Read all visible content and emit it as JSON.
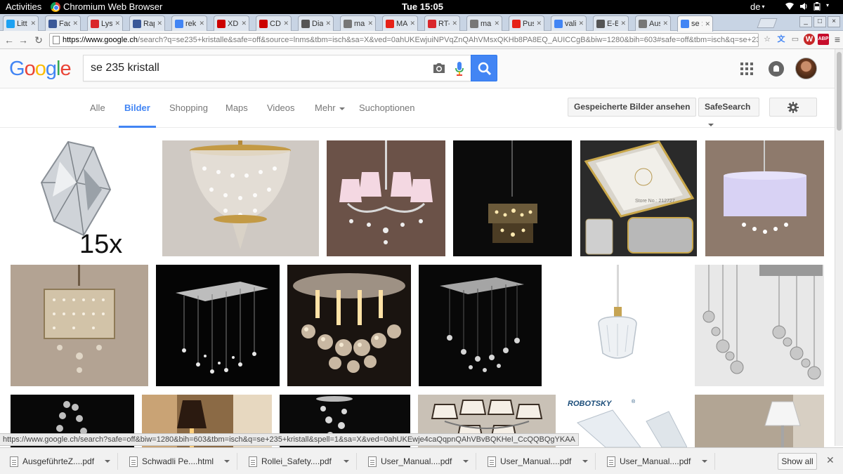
{
  "system_bar": {
    "activities": "Activities",
    "app_name": "Chromium Web Browser",
    "clock": "Tue 15:05",
    "keyboard_layout": "de"
  },
  "tabs": [
    {
      "label": "Litt",
      "icon": "twitter-icon",
      "color": "#1da1f2"
    },
    {
      "label": "Fac",
      "icon": "facebook-icon",
      "color": "#3b5998"
    },
    {
      "label": "Lys",
      "icon": "lys-icon",
      "color": "#d9262c"
    },
    {
      "label": "Rap",
      "icon": "facebook-icon",
      "color": "#3b5998"
    },
    {
      "label": "rek",
      "icon": "google-icon",
      "color": "#4285f4"
    },
    {
      "label": "XD",
      "icon": "digikey-icon",
      "color": "#cc0000"
    },
    {
      "label": "CD",
      "icon": "digikey-icon",
      "color": "#cc0000"
    },
    {
      "label": "Dia",
      "icon": "settings-icon",
      "color": "#555555"
    },
    {
      "label": "mar",
      "icon": "document-icon",
      "color": "#777777"
    },
    {
      "label": "MA",
      "icon": "youtube-icon",
      "color": "#e62117"
    },
    {
      "label": "RT-",
      "icon": "rt-icon",
      "color": "#d9262c"
    },
    {
      "label": "mar",
      "icon": "document-icon",
      "color": "#777777"
    },
    {
      "label": "Pus",
      "icon": "youtube-icon",
      "color": "#e62117"
    },
    {
      "label": "vali",
      "icon": "google-icon",
      "color": "#4285f4"
    },
    {
      "label": "E-B",
      "icon": "settings-icon",
      "color": "#555555"
    },
    {
      "label": "Aus",
      "icon": "document-icon",
      "color": "#777777"
    },
    {
      "label": "se :",
      "icon": "google-icon",
      "color": "#4285f4",
      "active": true
    }
  ],
  "omnibox": {
    "host": "https://www.google.ch",
    "path": "/search?q=se235+kristalle&safe=off&source=lnms&tbm=isch&sa=X&ved=0ahUKEwjuiNPVqZnQAhVMsxQKHb8PA8EQ_AUICCgB&biw=1280&bih=603#safe=off&tbm=isch&q=se+235+kristall"
  },
  "extensions": [
    {
      "icon": "shield-ext-icon",
      "glyph": "W",
      "color": "#c62828"
    },
    {
      "icon": "adblock-ext-icon",
      "glyph": "ABP",
      "badge": "31",
      "color": "#c70d2c"
    }
  ],
  "google": {
    "logo_letters": [
      "G",
      "o",
      "o",
      "g",
      "l",
      "e"
    ],
    "search_query": "se 235 kristall",
    "nav_tabs": [
      "Alle",
      "Bilder",
      "Shopping",
      "Maps",
      "Videos",
      "Mehr",
      "Suchoptionen"
    ],
    "active_tab": "Bilder",
    "saved_images_button": "Gespeicherte Bilder ansehen",
    "safesearch_button": "SafeSearch"
  },
  "results": {
    "row1": [
      {
        "subject": "crystal teardrop prism",
        "overlay": "15x",
        "bg": "#ffffff"
      },
      {
        "subject": "gold crystal basket chandelier",
        "bg": "#cfc9c3"
      },
      {
        "subject": "chandelier with pink lamp shades",
        "bg": "#6b5248"
      },
      {
        "subject": "drum crystal pendant on black",
        "bg": "#0b0b0b"
      },
      {
        "subject": "gold transparent phone case",
        "overlay": "Store No.: 212727",
        "bg": "#2a2a2a"
      },
      {
        "subject": "white drum crystal chandelier",
        "bg": "#8e7a6c"
      }
    ],
    "row2": [
      {
        "subject": "crystal drum chandelier",
        "bg": "#b3a393"
      },
      {
        "subject": "square crystal rain chandelier",
        "bg": "#050505"
      },
      {
        "subject": "round crystal ball ceiling lamp",
        "bg": "#1a1410"
      },
      {
        "subject": "square crystal ball ceiling lamp",
        "bg": "#080808"
      },
      {
        "subject": "glass pendant lamp",
        "bg": "#ffffff"
      },
      {
        "subject": "crystal ball spiral chandeliers",
        "bg": "#e8e8e8"
      }
    ],
    "row3": [
      {
        "subject": "crystal strand chandelier",
        "bg": "#080808"
      },
      {
        "subject": "lamp in warm room",
        "bg": "#8b6a45"
      },
      {
        "subject": "spiral crystal light",
        "bg": "#0a0a0a"
      },
      {
        "subject": "chandelier with shades",
        "bg": "#c9c1b6"
      },
      {
        "subject": "phone case ad",
        "overlay": "ROBOTSKY",
        "bg": "#ffffff"
      },
      {
        "subject": "white lamp in room",
        "bg": "#b2a594"
      }
    ]
  },
  "status_url": "https://www.google.ch/search?safe=off&biw=1280&bih=603&tbm=isch&q=se+235+kristall&spell=1&sa=X&ved=0ahUKEwje4caQqpnQAhVBvBQKHeI_CcQQBQgYKAA",
  "downloads": [
    "AusgeführteZ....pdf",
    "Schwadli Pe....html",
    "Rollei_Safety....pdf",
    "User_Manual....pdf",
    "User_Manual....pdf",
    "User_Manual....pdf"
  ],
  "show_all": "Show all"
}
